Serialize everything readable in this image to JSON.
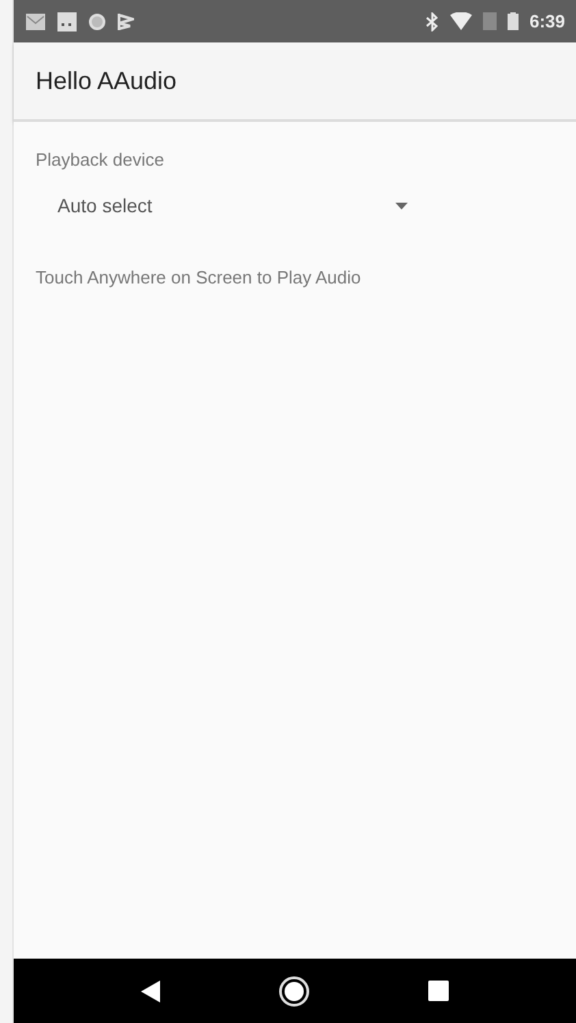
{
  "status_bar": {
    "time": "6:39"
  },
  "app_bar": {
    "title": "Hello AAudio"
  },
  "playback": {
    "label": "Playback device",
    "dropdown": {
      "value": "Auto select"
    }
  },
  "hint": "Touch Anywhere on Screen to Play Audio"
}
